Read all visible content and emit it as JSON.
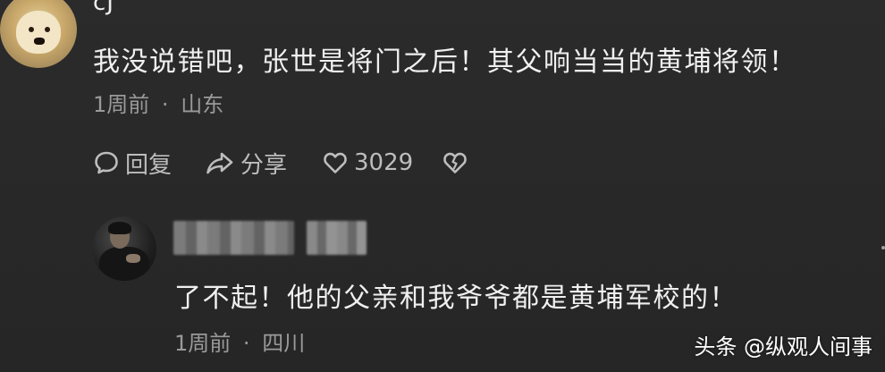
{
  "top_comment": {
    "username": "cJ",
    "text": "我没说错吧，张世是将门之后！其父响当当的黄埔将领！",
    "time": "1周前",
    "separator": "·",
    "location": "山东",
    "actions": {
      "reply_label": "回复",
      "share_label": "分享",
      "like_count": "3029"
    },
    "icons": {
      "reply": "comment-bubble-icon",
      "share": "share-arrow-icon",
      "like": "heart-icon",
      "dislike": "broken-heart-icon"
    }
  },
  "reply": {
    "text": "了不起！他的父亲和我爷爷都是黄埔军校的！",
    "time": "1周前",
    "separator": "·",
    "location": "四川"
  },
  "watermark": "头条 @纵观人间事",
  "colors": {
    "background": "#2a2a2a",
    "primary_text": "#f0f0f0",
    "secondary_text": "#9a9a9a",
    "icon": "#bdbdbd"
  }
}
